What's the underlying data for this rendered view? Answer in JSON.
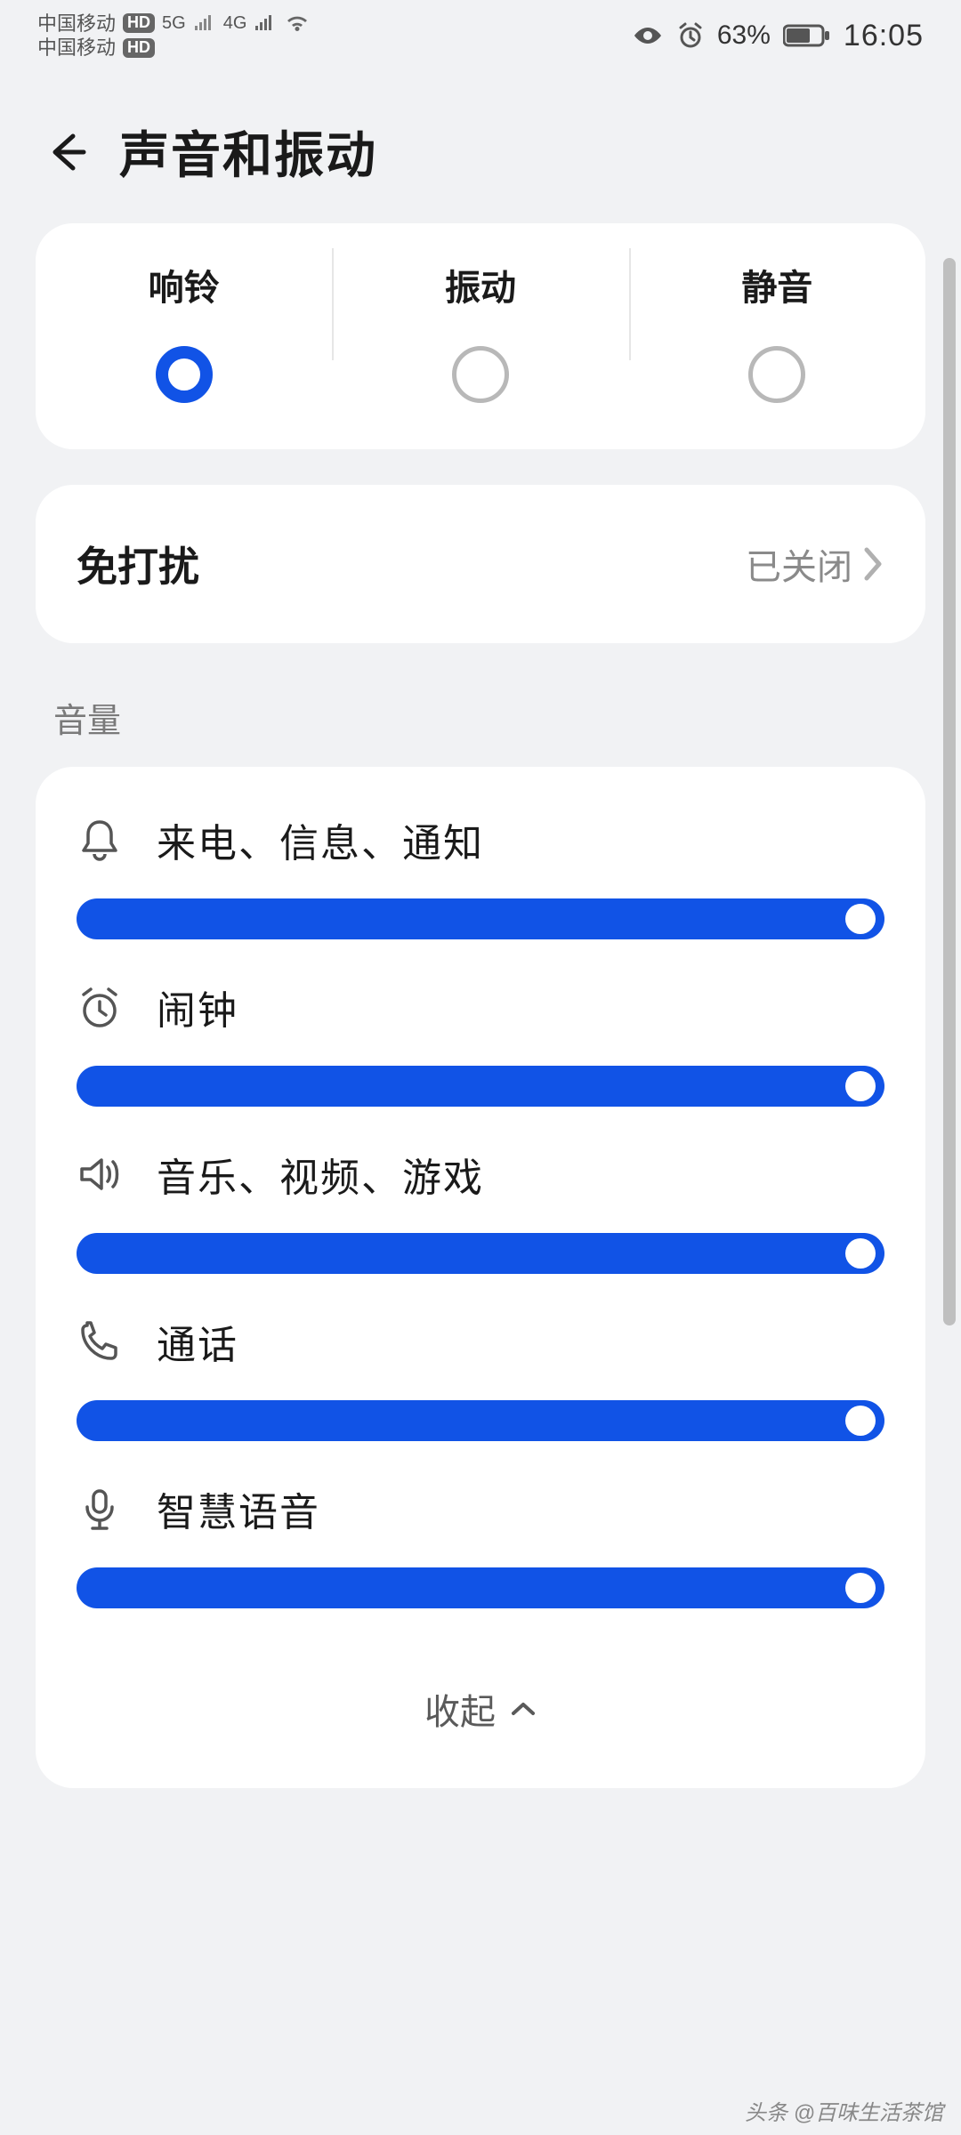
{
  "status": {
    "carrier1": "中国移动",
    "carrier2": "中国移动",
    "net1": "5G",
    "net2": "4G",
    "battery": "63%",
    "time": "16:05"
  },
  "header": {
    "title": "声音和振动"
  },
  "modes": {
    "ring": {
      "label": "响铃",
      "selected": true
    },
    "vibrate": {
      "label": "振动",
      "selected": false
    },
    "silent": {
      "label": "静音",
      "selected": false
    }
  },
  "dnd": {
    "label": "免打扰",
    "status": "已关闭"
  },
  "sections": {
    "volume": "音量"
  },
  "volumes": {
    "ringtone": {
      "label": "来电、信息、通知",
      "percent": 97
    },
    "alarm": {
      "label": "闹钟",
      "percent": 97
    },
    "media": {
      "label": "音乐、视频、游戏",
      "percent": 97
    },
    "call": {
      "label": "通话",
      "percent": 97
    },
    "voice": {
      "label": "智慧语音",
      "percent": 97
    }
  },
  "collapse": {
    "label": "收起"
  },
  "watermark": "头条 @百味生活茶馆"
}
